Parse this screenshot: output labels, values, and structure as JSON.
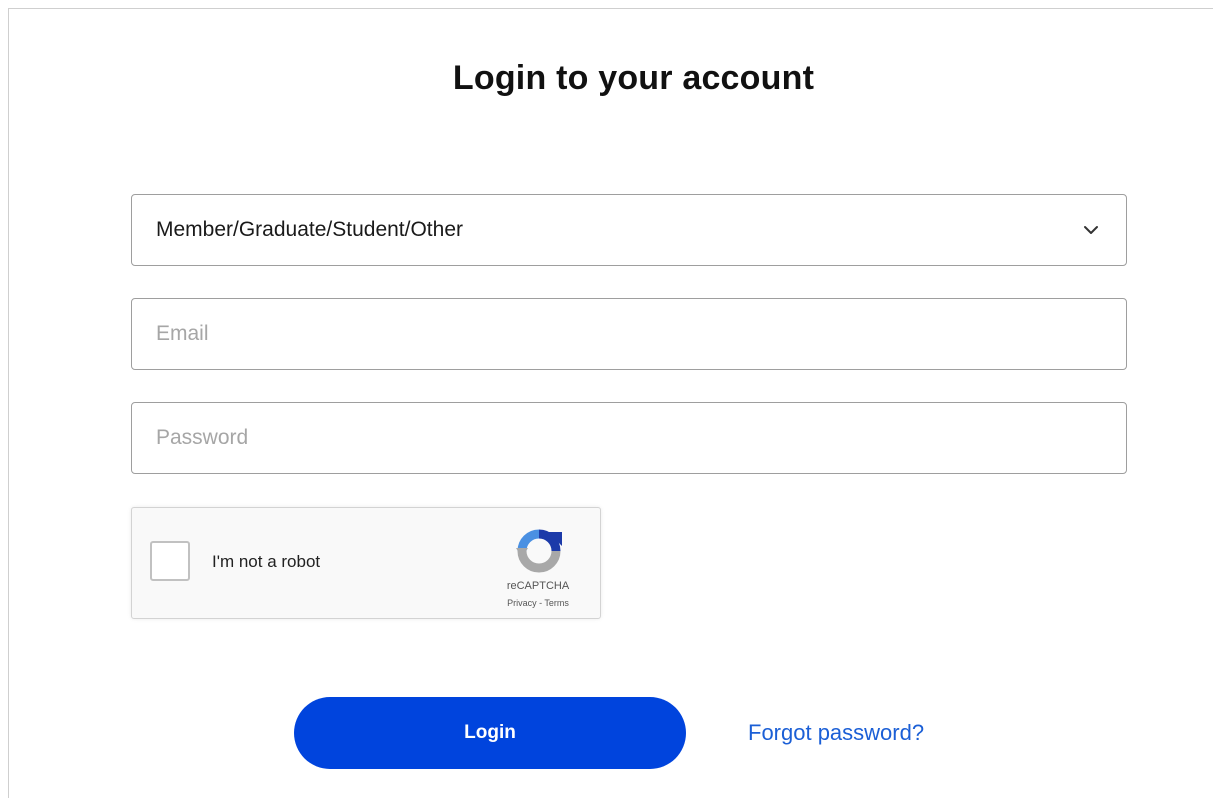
{
  "page": {
    "title": "Login to your account"
  },
  "form": {
    "account_type": {
      "selected": "Member/Graduate/Student/Other",
      "icon": "chevron-down-icon"
    },
    "email": {
      "placeholder": "Email",
      "value": ""
    },
    "password": {
      "placeholder": "Password",
      "value": ""
    }
  },
  "captcha": {
    "label": "I'm not a robot",
    "brand": "reCAPTCHA",
    "links": "Privacy - Terms",
    "checked": false,
    "icon": "recaptcha-logo-icon"
  },
  "actions": {
    "login_label": "Login",
    "forgot_label": "Forgot password?"
  },
  "colors": {
    "primary_button": "#0044dd",
    "link": "#1b5fd6",
    "border": "#9e9e9e"
  }
}
